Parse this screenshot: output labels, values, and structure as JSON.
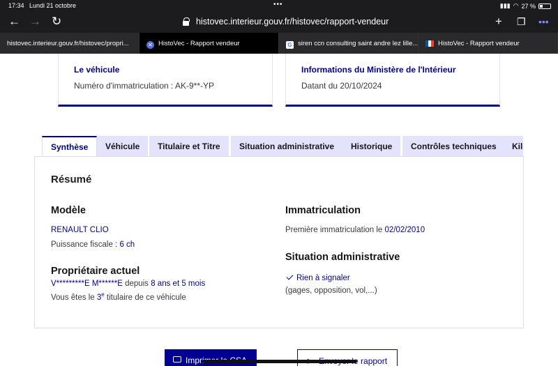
{
  "status": {
    "time": "17:34",
    "date": "Lundi 21 octobre",
    "battery": "27 %"
  },
  "browser": {
    "url": "histovec.interieur.gouv.fr/histovec/rapport-vendeur",
    "tabs": [
      {
        "title": "histovec.interieur.gouv.fr/histovec/propri..."
      },
      {
        "title": "HistoVec - Rapport vendeur"
      },
      {
        "title": "siren ccn consulting saint andre lez lille..."
      },
      {
        "title": "HistoVec - Rapport vendeur"
      }
    ]
  },
  "cards": {
    "vehicle": {
      "title": "Le véhicule",
      "text": "Numéro d'immatriculation : AK-9**-YP"
    },
    "ministry": {
      "title": "Informations du Ministère de l'Intérieur",
      "text": "Datant du 20/10/2024"
    }
  },
  "page_tabs": [
    "Synthèse",
    "Véhicule",
    "Titulaire et Titre",
    "Situation administrative",
    "Historique",
    "Contrôles techniques",
    "Kilo"
  ],
  "summary": {
    "heading": "Résumé",
    "model": {
      "heading": "Modèle",
      "name": "RENAULT CLIO",
      "power_label": "Puissance fiscale :",
      "power_value": "6 ch"
    },
    "owner": {
      "heading": "Propriétaire actuel",
      "name": "V*********E M******E",
      "since_label": "depuis",
      "since_value": "8 ans et 5 mois",
      "rank_pre": "Vous êtes le",
      "rank_num": "3",
      "rank_sup": "e",
      "rank_post": "titulaire de ce véhicule"
    },
    "registration": {
      "heading": "Immatriculation",
      "label": "Première immatriculation le",
      "date": "02/02/2010"
    },
    "admin": {
      "heading": "Situation administrative",
      "status": "Rien à signaler",
      "detail": "(gages, opposition, vol,...)"
    }
  },
  "actions": {
    "print": "Imprimer le CSA",
    "send": "Envoyer le rapport"
  }
}
